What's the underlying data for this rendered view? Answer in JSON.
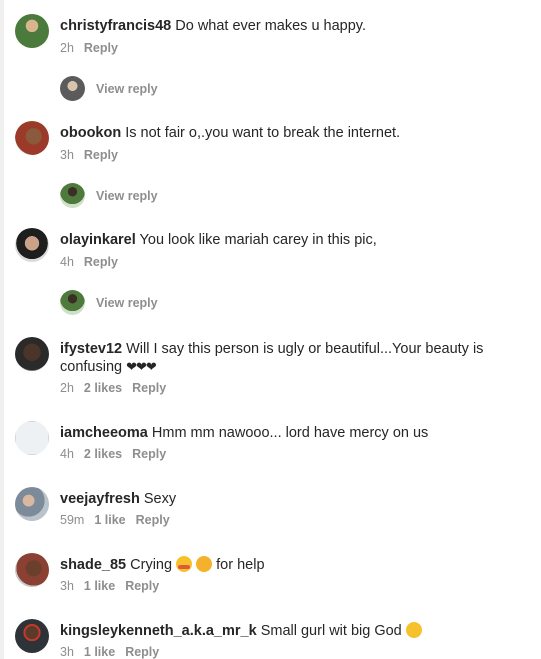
{
  "comments": [
    {
      "username": "christyfrancis48",
      "text": "Do what ever makes u happy.",
      "time": "2h",
      "likes": "",
      "reply": "Reply",
      "view_reply": "View reply",
      "avatar_color": "#4a7a3c"
    },
    {
      "username": "obookon",
      "text": "Is not fair o,.you want to break the internet.",
      "time": "3h",
      "likes": "",
      "reply": "Reply",
      "view_reply": "View reply",
      "avatar_color": "#9c3a2a"
    },
    {
      "username": "olayinkarel",
      "text": "You look like mariah carey in this pic,",
      "time": "4h",
      "likes": "",
      "reply": "Reply",
      "view_reply": "View reply",
      "avatar_color": "#c9a287"
    },
    {
      "username": "ifystev12",
      "text": "Will I say this person is ugly or beautiful...Your beauty is confusing",
      "text_hearts": "❤❤❤",
      "time": "2h",
      "likes": "2 likes",
      "reply": "Reply",
      "avatar_color": "#3b3b3b"
    },
    {
      "username": "iamcheeoma",
      "text": "Hmm mm nawooo... lord have mercy on us",
      "time": "4h",
      "likes": "2 likes",
      "reply": "Reply",
      "avatar_color": "#e9eef1"
    },
    {
      "username": "veejayfresh",
      "text": "Sexy",
      "time": "59m",
      "likes": "1 like",
      "reply": "Reply",
      "avatar_color": "#7c8a9a"
    },
    {
      "username": "shade_85",
      "text_before": "Crying",
      "text_after": "for help",
      "time": "3h",
      "likes": "1 like",
      "reply": "Reply",
      "avatar_color": "#8a4032"
    },
    {
      "username": "kingsleykenneth_a.k.a_mr_k",
      "text": "Small gurl wit big God",
      "time": "3h",
      "likes": "1 like",
      "reply": "Reply",
      "avatar_color": "#2e3338"
    }
  ],
  "reply_avatars": [
    "#5b5b5b",
    "#4f7a3d",
    "#4f7a3d"
  ]
}
